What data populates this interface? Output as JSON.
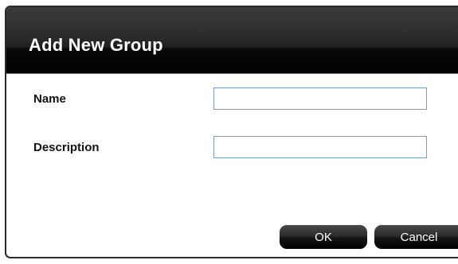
{
  "dialog": {
    "title": "Add New Group"
  },
  "form": {
    "name_label": "Name",
    "name_value": "",
    "description_label": "Description",
    "description_value": ""
  },
  "buttons": {
    "ok_label": "OK",
    "cancel_label": "Cancel"
  },
  "colors": {
    "title_bar": "#000000",
    "title_text": "#ffffff",
    "input_border": "#7a9cc4",
    "button_bg": "#1a1a1a"
  }
}
